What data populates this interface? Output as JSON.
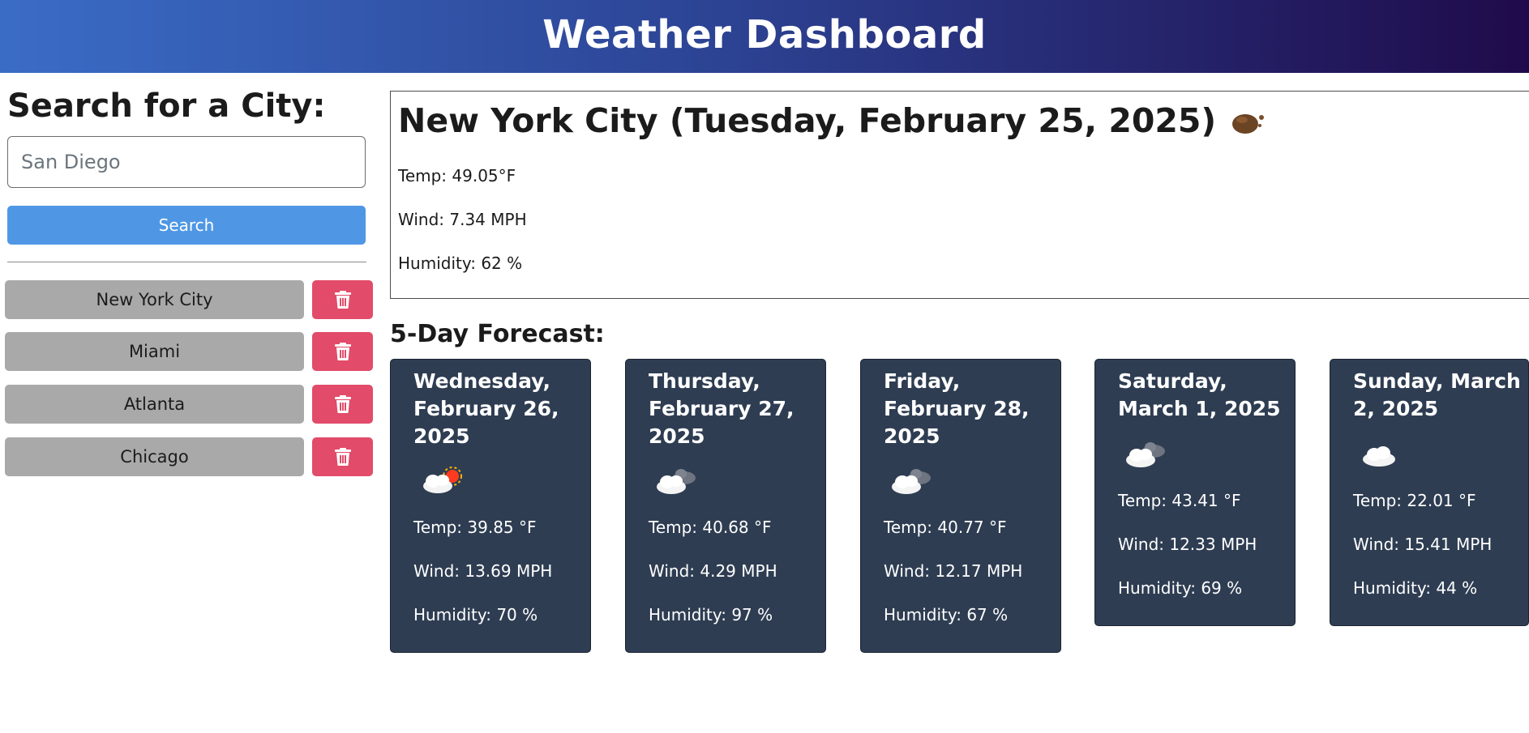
{
  "header": {
    "title": "Weather Dashboard"
  },
  "search": {
    "heading": "Search for a City:",
    "placeholder": "San Diego",
    "button_label": "Search"
  },
  "history": [
    {
      "city": "New York City"
    },
    {
      "city": "Miami"
    },
    {
      "city": "Atlanta"
    },
    {
      "city": "Chicago"
    }
  ],
  "current": {
    "title": "New York City (Tuesday, February 25, 2025)",
    "icon": "night-cloud-icon",
    "temp": "Temp: 49.05°F",
    "wind": "Wind: 7.34 MPH",
    "humidity": "Humidity: 62 %"
  },
  "forecast": {
    "heading": "5-Day Forecast:",
    "days": [
      {
        "date": "Wednesday, February 26, 2025",
        "icon": "partly-sunny-icon",
        "temp": "Temp: 39.85 °F",
        "wind": "Wind: 13.69 MPH",
        "humidity": "Humidity: 70 %"
      },
      {
        "date": "Thursday, February 27, 2025",
        "icon": "broken-clouds-icon",
        "temp": "Temp: 40.68 °F",
        "wind": "Wind: 4.29 MPH",
        "humidity": "Humidity: 97 %"
      },
      {
        "date": "Friday, February 28, 2025",
        "icon": "broken-clouds-icon",
        "temp": "Temp: 40.77 °F",
        "wind": "Wind: 12.17 MPH",
        "humidity": "Humidity: 67 %"
      },
      {
        "date": "Saturday, March 1, 2025",
        "icon": "broken-clouds-icon",
        "temp": "Temp: 43.41 °F",
        "wind": "Wind: 12.33 MPH",
        "humidity": "Humidity: 69 %"
      },
      {
        "date": "Sunday, March 2, 2025",
        "icon": "cloud-icon",
        "temp": "Temp: 22.01 °F",
        "wind": "Wind: 15.41 MPH",
        "humidity": "Humidity: 44 %"
      }
    ]
  },
  "colors": {
    "header_start": "#3a6cc6",
    "header_end": "#1f0b4b",
    "search_button": "#4f97e5",
    "history_button": "#a9a9a9",
    "delete_button": "#e24b69",
    "card_background": "#2e3d52"
  }
}
